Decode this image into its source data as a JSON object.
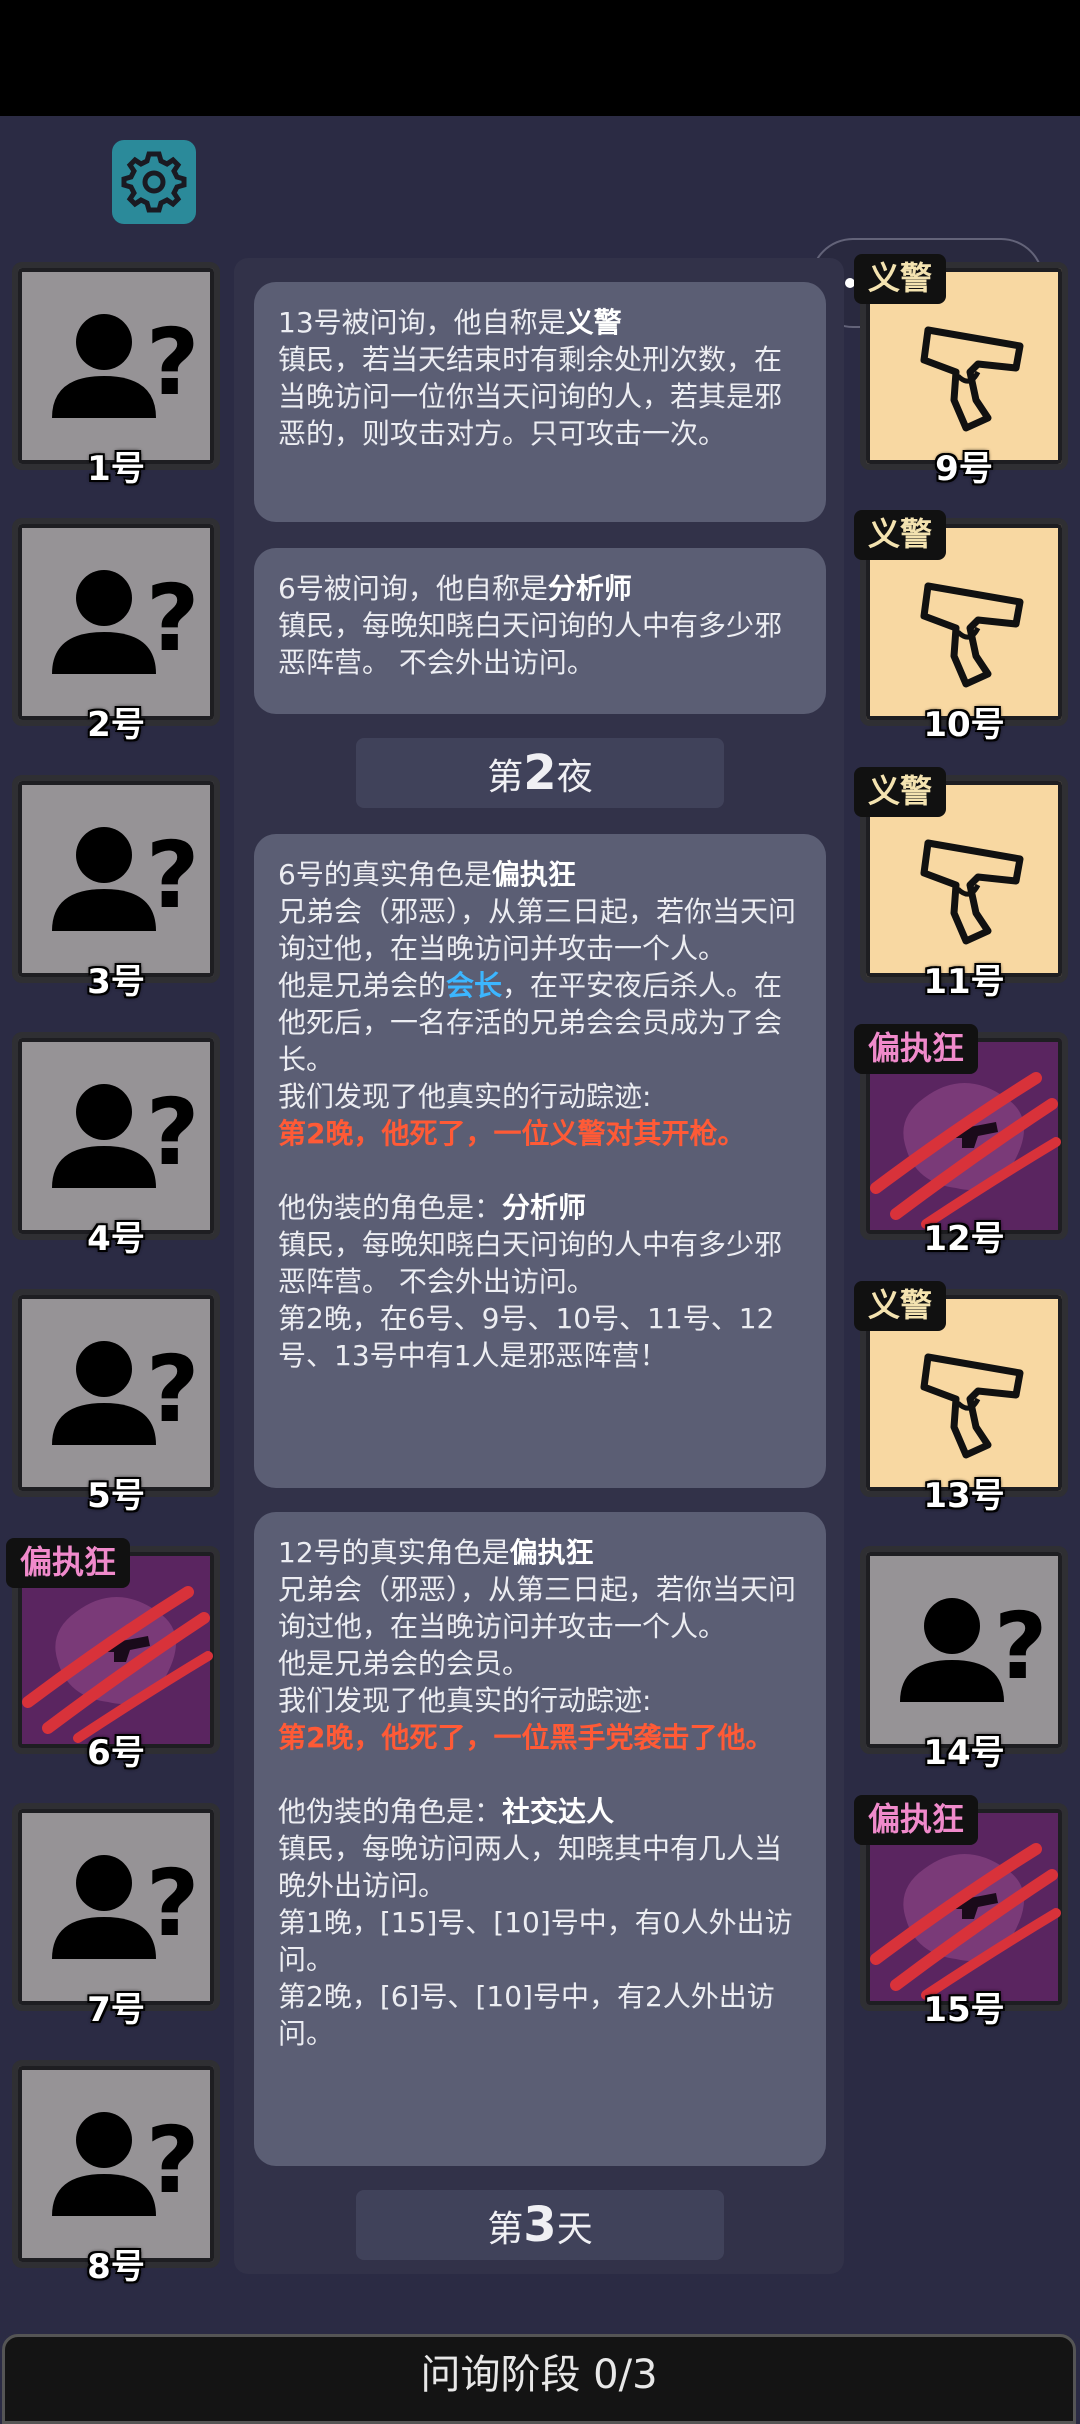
{
  "header": {
    "settings_icon": "gear-icon"
  },
  "mini_program": {
    "menu_icon": "more-dots-icon",
    "close_icon": "target-circle-icon"
  },
  "left_players": [
    {
      "label": "1号",
      "type": "unknown",
      "role": ""
    },
    {
      "label": "2号",
      "type": "unknown",
      "role": ""
    },
    {
      "label": "3号",
      "type": "unknown",
      "role": ""
    },
    {
      "label": "4号",
      "type": "unknown",
      "role": ""
    },
    {
      "label": "5号",
      "type": "unknown",
      "role": ""
    },
    {
      "label": "6号",
      "type": "evil",
      "role": "偏执狂"
    },
    {
      "label": "7号",
      "type": "unknown",
      "role": ""
    },
    {
      "label": "8号",
      "type": "unknown",
      "role": ""
    }
  ],
  "right_players": [
    {
      "label": "9号",
      "type": "pistol",
      "role": "义警"
    },
    {
      "label": "10号",
      "type": "pistol",
      "role": "义警"
    },
    {
      "label": "11号",
      "type": "pistol",
      "role": "义警"
    },
    {
      "label": "12号",
      "type": "evil",
      "role": "偏执狂"
    },
    {
      "label": "13号",
      "type": "pistol",
      "role": "义警"
    },
    {
      "label": "14号",
      "type": "unknown",
      "role": ""
    },
    {
      "label": "15号",
      "type": "evil",
      "role": "偏执狂"
    }
  ],
  "log": {
    "msg1": {
      "line1_prefix": "13号被问询，他自称是",
      "line1_role": "义警",
      "desc": "镇民，若当天结束时有剩余处刑次数，在当晚访问一位你当天问询的人，若其是邪恶的，则攻击对方。只可攻击一次。"
    },
    "msg2": {
      "line1_prefix": "6号被问询，他自称是",
      "line1_role": "分析师",
      "desc": "镇民，每晚知晓白天问询的人中有多少邪恶阵营。 不会外出访问。"
    },
    "night_divider": {
      "prefix": "第",
      "num": "2",
      "suffix": "夜"
    },
    "msg3": {
      "true_prefix": "6号的真实角色是",
      "true_role": "偏执狂",
      "true_desc": "兄弟会（邪恶），从第三日起，若你当天问询过他，在当晚访问并攻击一个人。",
      "member_prefix": "他是兄弟会的",
      "member_role": "会长",
      "member_suffix": "，在平安夜后杀人。在他死后，一名存活的兄弟会会员成为了会长。",
      "trace_label": "我们发现了他真实的行动踪迹:",
      "trace_text": "第2晚，他死了，一位义警对其开枪。",
      "disguise_prefix": "他伪装的角色是：",
      "disguise_role": "分析师",
      "disguise_desc": "镇民，每晚知晓白天问询的人中有多少邪恶阵营。 不会外出访问。",
      "result": "第2晚，在6号、9号、10号、11号、12号、13号中有1人是邪恶阵营！"
    },
    "msg4": {
      "true_prefix": "12号的真实角色是",
      "true_role": "偏执狂",
      "true_desc": "兄弟会（邪恶），从第三日起，若你当天问询过他，在当晚访问并攻击一个人。",
      "member_text": "他是兄弟会的会员。",
      "trace_label": "我们发现了他真实的行动踪迹:",
      "trace_text": "第2晚，他死了，一位黑手党袭击了他。",
      "disguise_prefix": "他伪装的角色是：",
      "disguise_role": "社交达人",
      "disguise_desc": "镇民，每晚访问两人，知晓其中有几人当晚外出访问。",
      "result1": "第1晚，[15]号、[10]号中，有0人外出访问。",
      "result2": "第2晚，[6]号、[10]号中，有2人外出访问。"
    },
    "day_divider": {
      "prefix": "第",
      "num": "3",
      "suffix": "天"
    }
  },
  "phase_bar": {
    "text": "问询阶段 0/3"
  }
}
